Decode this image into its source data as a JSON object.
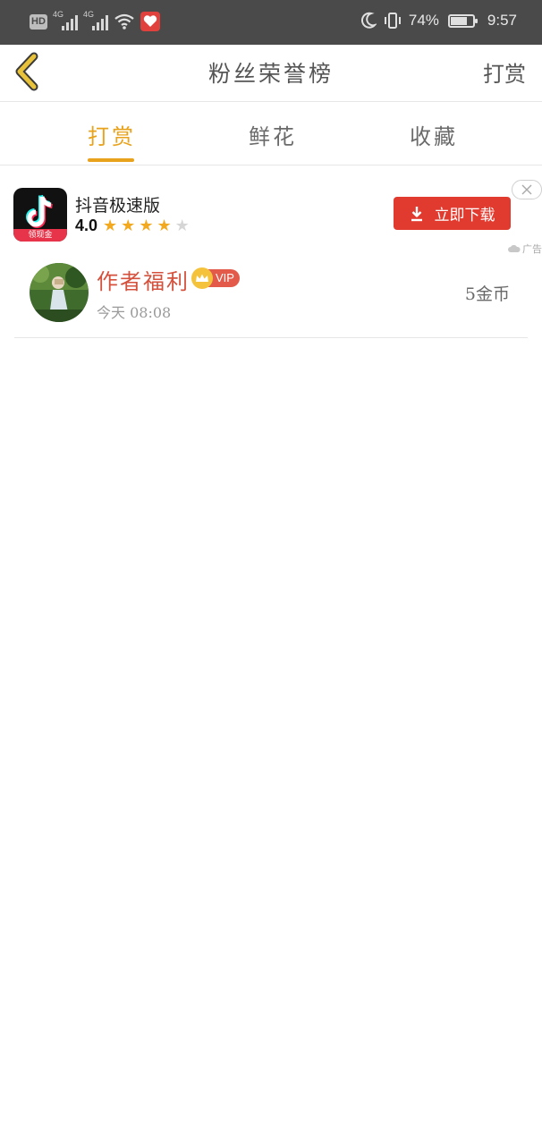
{
  "status_bar": {
    "hd": "HD",
    "network_1": "4G",
    "network_2": "4G",
    "battery_percent": "74%",
    "battery_level": 0.74,
    "time": "9:57"
  },
  "header": {
    "title": "粉丝荣誉榜",
    "action_label": "打赏",
    "back_icon": "chevron-left-icon",
    "back_color": "#e8c23a"
  },
  "tabs": {
    "items": [
      {
        "label": "打赏",
        "active": true
      },
      {
        "label": "鲜花",
        "active": false
      },
      {
        "label": "收藏",
        "active": false
      }
    ],
    "active_color": "#e8a21b"
  },
  "ad": {
    "app_name": "抖音极速版",
    "icon_ribbon": "领现金",
    "rating": "4.0",
    "stars": 4,
    "stars_total": 5,
    "download_label": "立即下载",
    "ad_label": "广告",
    "button_color": "#e13a2f"
  },
  "list": {
    "items": [
      {
        "name": "作者福利",
        "badge": "VIP",
        "time": "今天 08:08",
        "amount": "5金币"
      }
    ]
  }
}
